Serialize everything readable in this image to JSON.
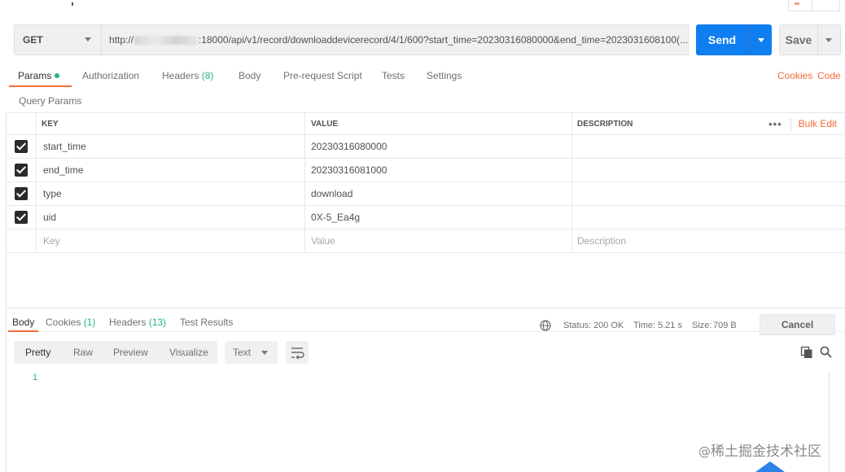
{
  "request": {
    "method": "GET",
    "url_prefix": "http://",
    "url_suffix": ":18000/api/v1/record/downloaddevicerecord/4/1/600?start_time=20230316080000&end_time=2023031608100(...",
    "send_label": "Send",
    "save_label": "Save"
  },
  "req_tabs": {
    "params": "Params",
    "authorization": "Authorization",
    "headers": "Headers",
    "headers_count": "(8)",
    "body": "Body",
    "prerequest": "Pre-request Script",
    "tests": "Tests",
    "settings": "Settings",
    "cookies": "Cookies",
    "code": "Code"
  },
  "query_params": {
    "title": "Query Params",
    "columns": {
      "key": "KEY",
      "value": "VALUE",
      "description": "DESCRIPTION"
    },
    "more": "•••",
    "bulk_edit": "Bulk Edit",
    "rows": [
      {
        "key": "start_time",
        "value": "20230316080000",
        "description": ""
      },
      {
        "key": "end_time",
        "value": "20230316081000",
        "description": ""
      },
      {
        "key": "type",
        "value": "download",
        "description": ""
      },
      {
        "key": "uid",
        "value": "0X-5_Ea4g",
        "description": ""
      }
    ],
    "placeholder": {
      "key": "Key",
      "value": "Value",
      "description": "Description"
    }
  },
  "response": {
    "tabs": {
      "body": "Body",
      "cookies": "Cookies",
      "cookies_count": "(1)",
      "headers": "Headers",
      "headers_count": "(13)",
      "test_results": "Test Results"
    },
    "status_label": "Status:",
    "status_value": "200 OK",
    "time_label": "Time:",
    "time_value": "5.21 s",
    "size_label": "Size:",
    "size_value": "709 B",
    "cancel_label": "Cancel",
    "formats": {
      "pretty": "Pretty",
      "raw": "Raw",
      "preview": "Preview",
      "visualize": "Visualize"
    },
    "type_select": "Text",
    "line_number": "1"
  },
  "watermark": {
    "at": "@",
    "text": "稀土掘金技术社区"
  },
  "colors": {
    "accent": "#f26b3a",
    "send": "#0f7ef0",
    "success": "#26b47f"
  }
}
